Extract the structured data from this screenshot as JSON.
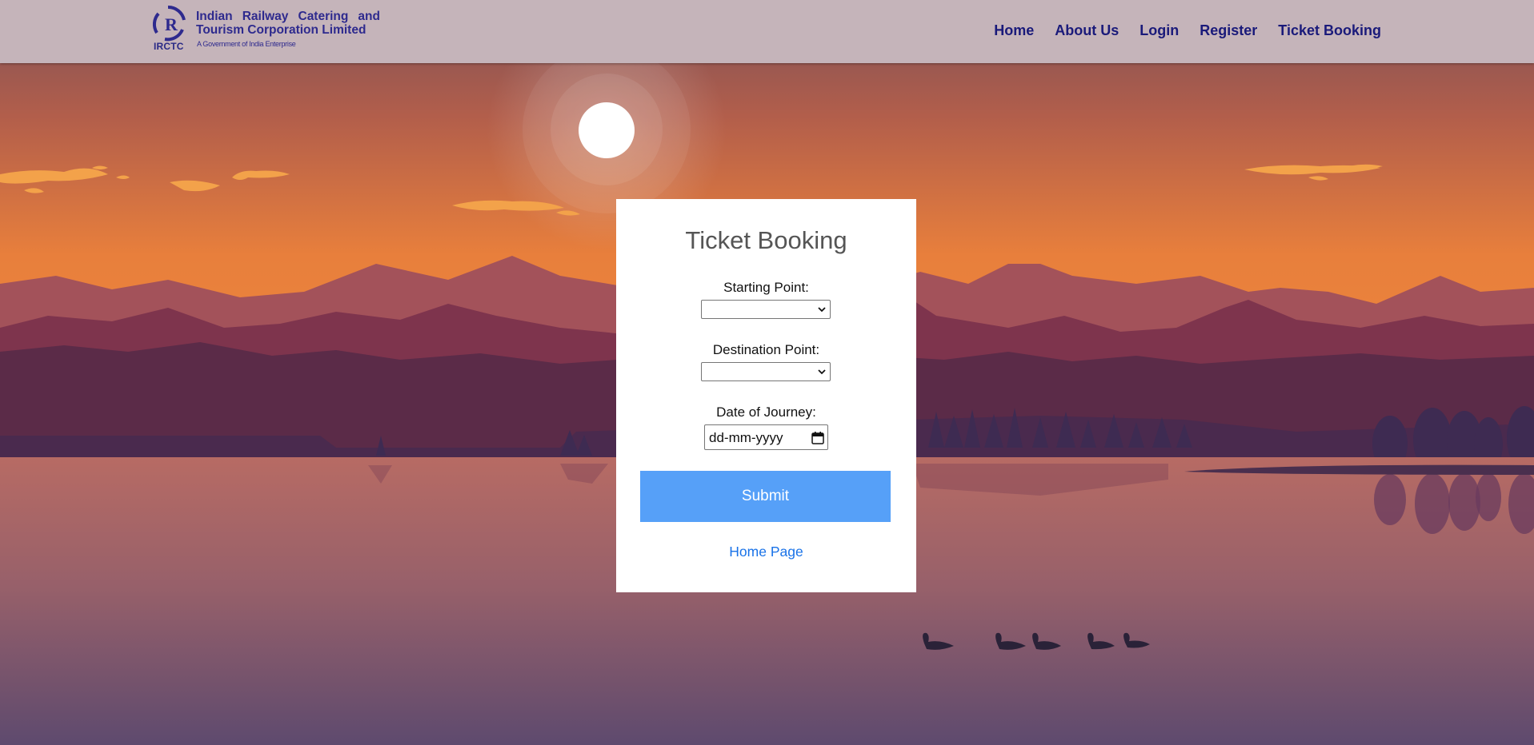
{
  "header": {
    "logo_short": "IRCTC",
    "org_name": "Indian Railway Catering and Tourism Corporation Limited",
    "tagline": "A Government of India Enterprise",
    "nav": [
      "Home",
      "About Us",
      "Login",
      "Register",
      "Ticket Booking"
    ]
  },
  "form": {
    "title": "Ticket Booking",
    "starting_label": "Starting Point:",
    "starting_value": "",
    "destination_label": "Destination Point:",
    "destination_value": "",
    "date_label": "Date of Journey:",
    "date_placeholder": "dd-mm-yyyy",
    "submit_label": "Submit",
    "home_link": "Home Page"
  },
  "colors": {
    "header_bg": "#c5b4ba",
    "nav_text": "#1a1a7a",
    "submit_bg": "#56a0f8",
    "link": "#1a73e8"
  },
  "icons": [
    "irctc-logo-icon",
    "chevron-down-icon",
    "calendar-icon"
  ]
}
